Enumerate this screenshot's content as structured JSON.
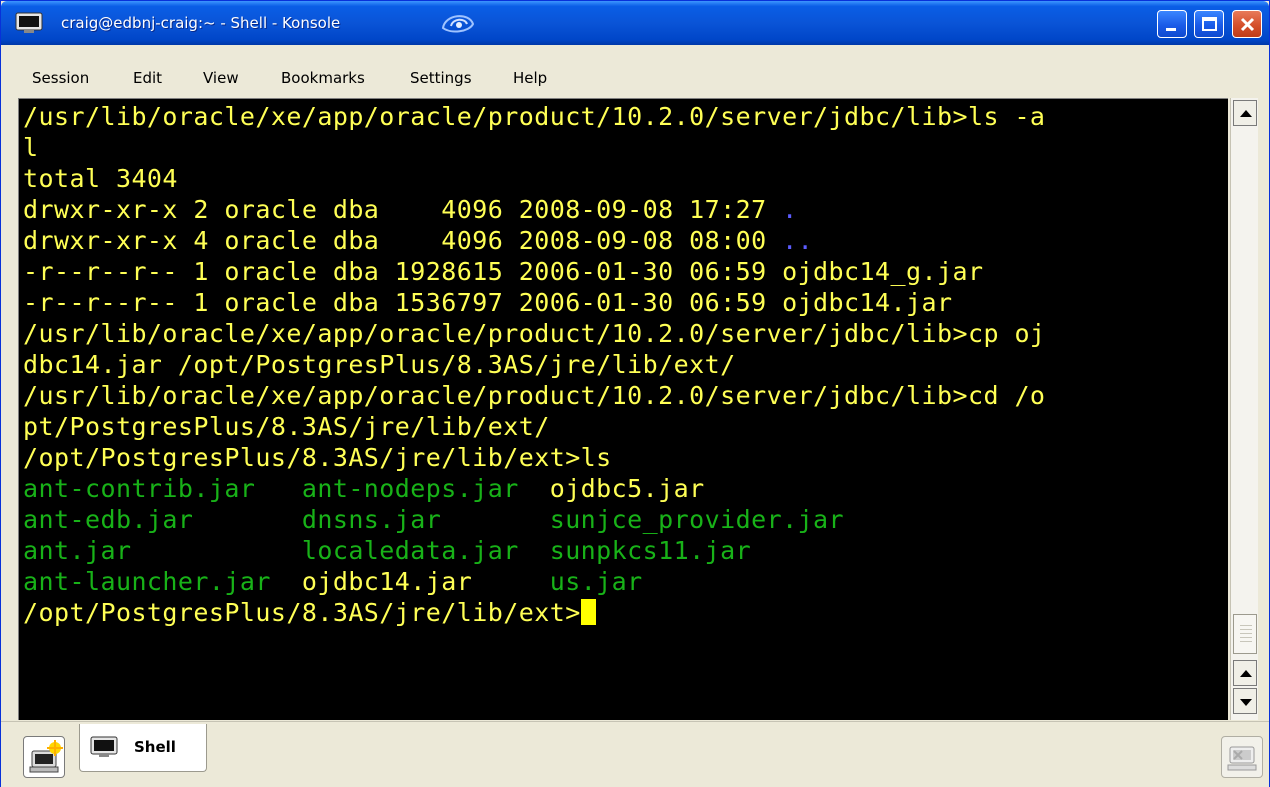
{
  "window": {
    "title": "craig@edbnj-craig:~ - Shell - Konsole"
  },
  "menu": [
    "Session",
    "Edit",
    "View",
    "Bookmarks",
    "Settings",
    "Help"
  ],
  "terminal": {
    "lines": [
      {
        "segments": [
          {
            "text": "/usr/lib/oracle/xe/app/oracle/product/10.2.0/server/jdbc/lib>ls -a",
            "color": "yellow"
          }
        ]
      },
      {
        "segments": [
          {
            "text": "l",
            "color": "yellow"
          }
        ]
      },
      {
        "segments": [
          {
            "text": "total 3404",
            "color": "yellow"
          }
        ]
      },
      {
        "segments": [
          {
            "text": "drwxr-xr-x 2 oracle dba    4096 2008-09-08 17:27 ",
            "color": "yellow"
          },
          {
            "text": ".",
            "color": "blue"
          }
        ]
      },
      {
        "segments": [
          {
            "text": "drwxr-xr-x 4 oracle dba    4096 2008-09-08 08:00 ",
            "color": "yellow"
          },
          {
            "text": "..",
            "color": "blue"
          }
        ]
      },
      {
        "segments": [
          {
            "text": "-r--r--r-- 1 oracle dba 1928615 2006-01-30 06:59 ojdbc14_g.jar",
            "color": "yellow"
          }
        ]
      },
      {
        "segments": [
          {
            "text": "-r--r--r-- 1 oracle dba 1536797 2006-01-30 06:59 ojdbc14.jar",
            "color": "yellow"
          }
        ]
      },
      {
        "segments": [
          {
            "text": "/usr/lib/oracle/xe/app/oracle/product/10.2.0/server/jdbc/lib>cp oj",
            "color": "yellow"
          }
        ]
      },
      {
        "segments": [
          {
            "text": "dbc14.jar /opt/PostgresPlus/8.3AS/jre/lib/ext/",
            "color": "yellow"
          }
        ]
      },
      {
        "segments": [
          {
            "text": "/usr/lib/oracle/xe/app/oracle/product/10.2.0/server/jdbc/lib>cd /o",
            "color": "yellow"
          }
        ]
      },
      {
        "segments": [
          {
            "text": "pt/PostgresPlus/8.3AS/jre/lib/ext/",
            "color": "yellow"
          }
        ]
      },
      {
        "segments": [
          {
            "text": "/opt/PostgresPlus/8.3AS/jre/lib/ext>ls",
            "color": "yellow"
          }
        ]
      },
      {
        "segments": [
          {
            "text": "ant-contrib.jar   ant-nodeps.jar  ",
            "color": "green"
          },
          {
            "text": "ojdbc5.jar",
            "color": "yellow"
          }
        ]
      },
      {
        "segments": [
          {
            "text": "ant-edb.jar       dnsns.jar       sunjce_provider.jar",
            "color": "green"
          }
        ]
      },
      {
        "segments": [
          {
            "text": "ant.jar           localedata.jar  sunpkcs11.jar",
            "color": "green"
          }
        ]
      },
      {
        "segments": [
          {
            "text": "ant-launcher.jar  ",
            "color": "green"
          },
          {
            "text": "ojdbc14.jar",
            "color": "yellow"
          },
          {
            "text": "     us.jar",
            "color": "green"
          }
        ]
      },
      {
        "segments": [
          {
            "text": "/opt/PostgresPlus/8.3AS/jre/lib/ext>",
            "color": "yellow"
          }
        ],
        "cursor": true
      }
    ]
  },
  "tabs": [
    {
      "label": "Shell",
      "active": true
    }
  ],
  "colors": {
    "yellow": "#ffff55",
    "green": "#18b218",
    "blue": "#5c5cff",
    "terminal_bg": "#000000",
    "cursor": "#ffff00",
    "titlebar": "#0a54d7"
  },
  "icons": [
    "terminal-icon",
    "minimize-icon",
    "maximize-icon",
    "close-icon",
    "new-session-icon",
    "close-session-icon"
  ]
}
